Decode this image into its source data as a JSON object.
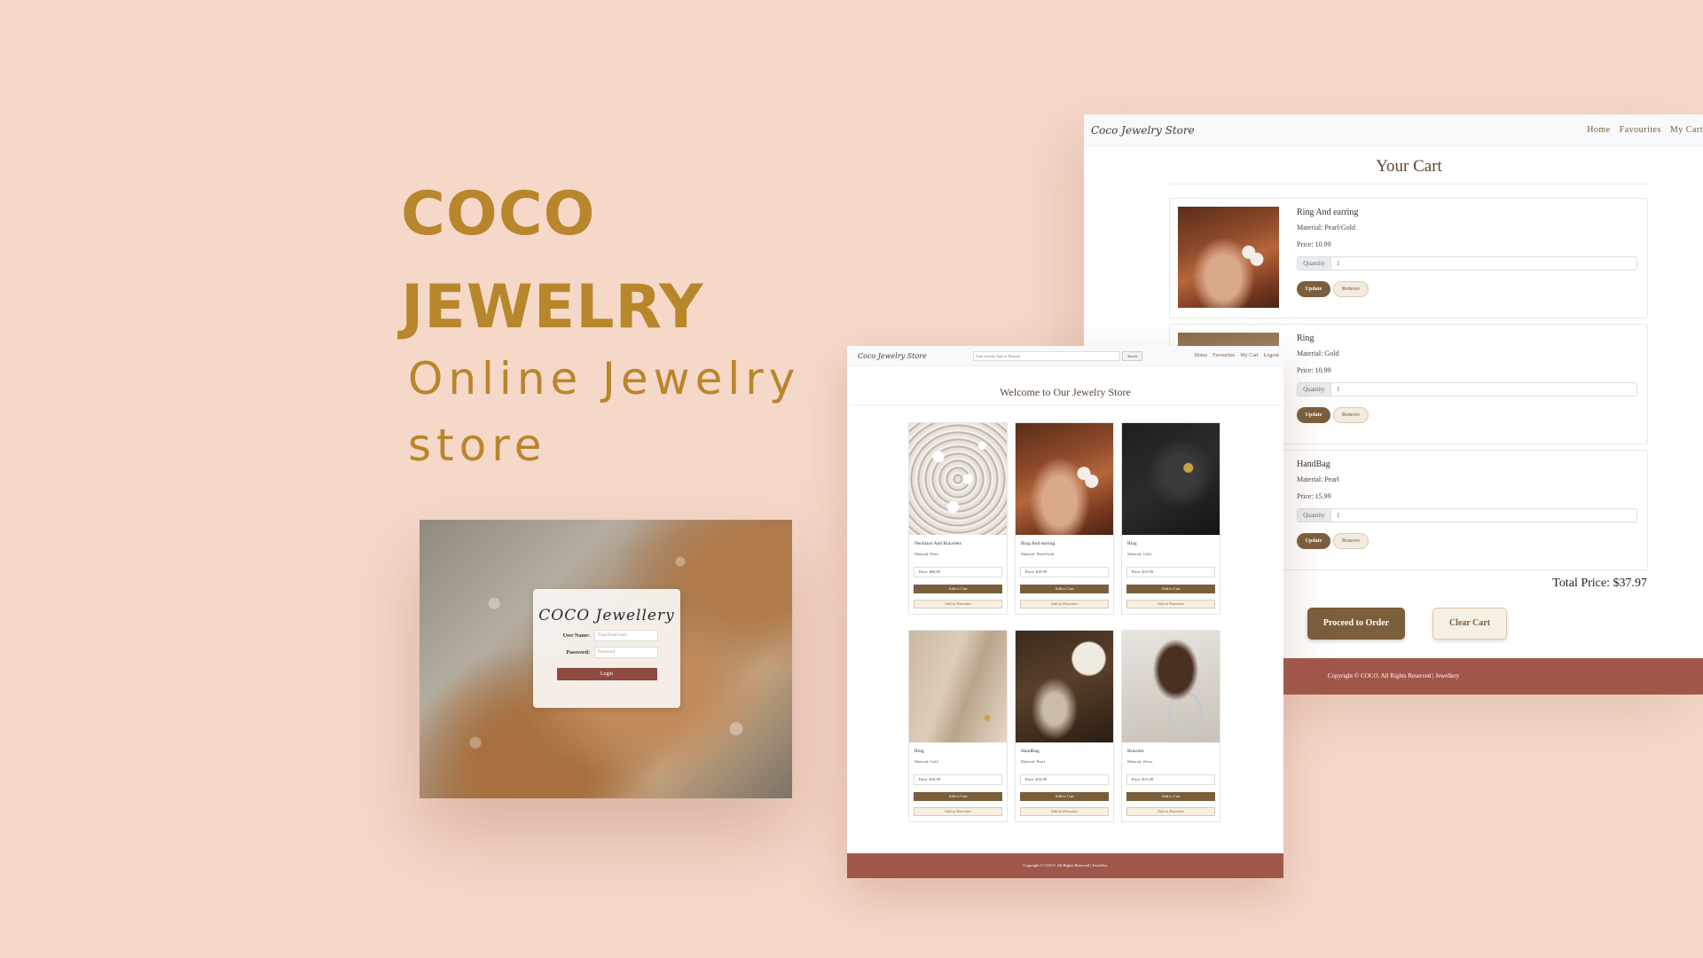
{
  "hero": {
    "title_line1": "COCO",
    "title_line2": "JEWELRY",
    "subtitle_line1": "Online Jewelry",
    "subtitle_line2": "store"
  },
  "login": {
    "logo": "COCO Jewellery",
    "username_label": "User Name:",
    "username_placeholder": "Your Email here",
    "password_label": "Password:",
    "password_placeholder": "Password",
    "login_button": "Login"
  },
  "cart_page": {
    "brand": "Coco Jewelry Store",
    "nav": [
      "Home",
      "Favourites",
      "My Cart"
    ],
    "title": "Your Cart",
    "items": [
      {
        "name": "Ring And earring",
        "material": "Material: Pearl/Gold",
        "price": "Price: 10.99",
        "quantity_label": "Quantity",
        "quantity": "1",
        "update": "Update",
        "remove": "Remove",
        "image": "earring-photo"
      },
      {
        "name": "Ring",
        "material": "Material: Gold",
        "price": "Price: 10.99",
        "quantity_label": "Quantity",
        "quantity": "1",
        "update": "Update",
        "remove": "Remove",
        "image": "ring-photo"
      },
      {
        "name": "HandBag",
        "material": "Material: Pearl",
        "price": "Price: 15.99",
        "quantity_label": "Quantity",
        "quantity": "1",
        "update": "Update",
        "remove": "Remove",
        "image": "handbag-photo"
      }
    ],
    "total": "Total Price: $37.97",
    "proceed_button": "Proceed to Order",
    "clear_button": "Clear Cart",
    "footer": "Copyright © COCO. All Rights Reserved | Jewellery"
  },
  "home_page": {
    "brand": "Coco Jewelry Store",
    "search_placeholder": "Enter Jewelry Type or Material",
    "search_button": "Search",
    "nav": [
      "Home",
      "Favourites",
      "My Cart",
      "Logout"
    ],
    "welcome": "Welcome to Our Jewelry Store",
    "products": [
      {
        "name": "Necklace And Bracelets",
        "material": "Material: Pearl",
        "price": "Price: $60.99",
        "add_cart": "Add to Cart",
        "add_fav": "Add to Favorites",
        "image": "necklace-photo"
      },
      {
        "name": "Ring And earring",
        "material": "Material: Pearl/Gold",
        "price": "Price: $10.99",
        "add_cart": "Add to Cart",
        "add_fav": "Add to Favorites",
        "image": "earring-photo"
      },
      {
        "name": "Ring",
        "material": "Material: Gold",
        "price": "Price: $15.99",
        "add_cart": "Add to Cart",
        "add_fav": "Add to Favorites",
        "image": "ring-dark-photo"
      },
      {
        "name": "Ring",
        "material": "Material: Gold",
        "price": "Price: $10.99",
        "add_cart": "Add to Cart",
        "add_fav": "Add to Favorites",
        "image": "ring-beige-photo"
      },
      {
        "name": "HandBag",
        "material": "Material: Pearl",
        "price": "Price: $15.99",
        "add_cart": "Add to Cart",
        "add_fav": "Add to Favorites",
        "image": "handbag-photo"
      },
      {
        "name": "Bracelet",
        "material": "Material: Silver",
        "price": "Price: $15.99",
        "add_cart": "Add to Cart",
        "add_fav": "Add to Favorites",
        "image": "bracelet-photo"
      }
    ],
    "footer": "Copyright © COCO. All Rights Reserved | Jewellery"
  },
  "colors": {
    "background": "#f6d8c9",
    "accent_gold": "#b8862b",
    "primary_brown": "#7b5e3c",
    "footer_red": "#a0574a"
  }
}
